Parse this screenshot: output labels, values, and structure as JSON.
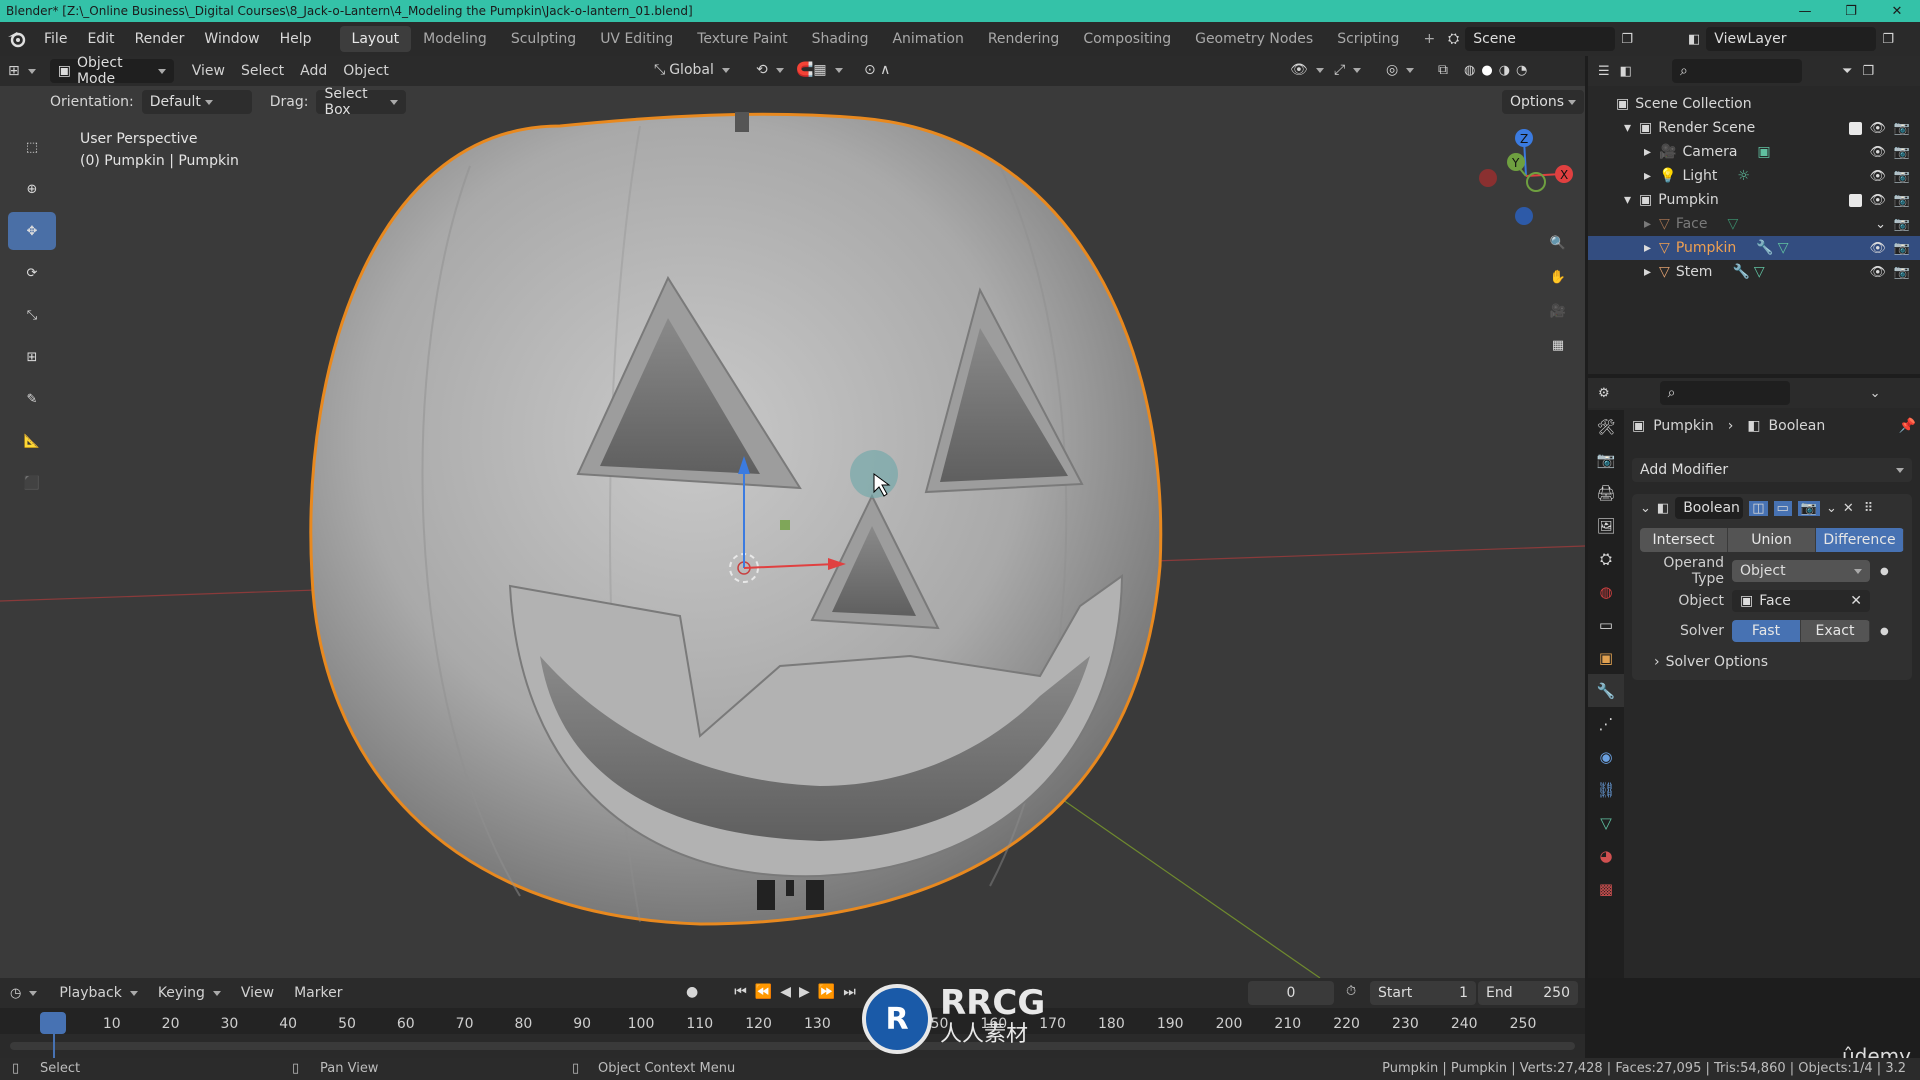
{
  "window": {
    "title": "Blender* [Z:\\_Online Business\\_Digital Courses\\8_Jack-o-Lantern\\4_Modeling the Pumpkin\\Jack-o-lantern_01.blend]",
    "controls": [
      "—",
      "❐",
      "✕"
    ]
  },
  "menu": [
    "File",
    "Edit",
    "Render",
    "Window",
    "Help"
  ],
  "workspaces": [
    "Layout",
    "Modeling",
    "Sculpting",
    "UV Editing",
    "Texture Paint",
    "Shading",
    "Animation",
    "Rendering",
    "Compositing",
    "Geometry Nodes",
    "Scripting"
  ],
  "active_workspace": "Layout",
  "scene_name": "Scene",
  "view_layer": "ViewLayer",
  "viewport_header": {
    "mode": "Object Mode",
    "menus": [
      "View",
      "Select",
      "Add",
      "Object"
    ],
    "transform_orientation": "Global",
    "orientation_label": "Orientation:",
    "orientation_value": "Default",
    "drag_label": "Drag:",
    "drag_value": "Select Box",
    "options": "Options"
  },
  "viewport": {
    "perspective": "User Perspective",
    "object_info": "(0) Pumpkin | Pumpkin"
  },
  "gizmo": {
    "z": "Z",
    "y": "Y",
    "x": "X"
  },
  "outliner": {
    "root": "Scene Collection",
    "rows": [
      {
        "label": "Render Scene",
        "indent": 1,
        "type": "collection"
      },
      {
        "label": "Camera",
        "indent": 2,
        "type": "camera"
      },
      {
        "label": "Light",
        "indent": 2,
        "type": "light"
      },
      {
        "label": "Pumpkin",
        "indent": 1,
        "type": "collection"
      },
      {
        "label": "Face",
        "indent": 2,
        "type": "mesh-hidden"
      },
      {
        "label": "Pumpkin",
        "indent": 2,
        "type": "mesh-selected"
      },
      {
        "label": "Stem",
        "indent": 2,
        "type": "mesh"
      }
    ]
  },
  "properties": {
    "breadcrumb_object": "Pumpkin",
    "breadcrumb_modifier": "Boolean",
    "add_modifier": "Add Modifier",
    "modifier_name": "Boolean",
    "operations": [
      "Intersect",
      "Union",
      "Difference"
    ],
    "active_operation": "Difference",
    "operand_type_label": "Operand Type",
    "operand_type_value": "Object",
    "object_label": "Object",
    "object_value": "Face",
    "solver_label": "Solver",
    "solvers": [
      "Fast",
      "Exact"
    ],
    "active_solver": "Fast",
    "solver_options": "Solver Options"
  },
  "timeline": {
    "menus": [
      "Playback",
      "Keying",
      "View",
      "Marker"
    ],
    "current_frame": "0",
    "start_label": "Start",
    "start_value": "1",
    "end_label": "End",
    "end_value": "250",
    "ticks": [
      "0",
      "10",
      "20",
      "30",
      "40",
      "50",
      "60",
      "70",
      "80",
      "90",
      "100",
      "110",
      "120",
      "130",
      "140",
      "150",
      "160",
      "170",
      "180",
      "190",
      "200",
      "210",
      "220",
      "230",
      "240",
      "250"
    ]
  },
  "watermark": {
    "brand": "RRCG",
    "sub": "人人素材",
    "udemy": "ûdemy"
  },
  "statusbar": {
    "left": "Select",
    "middle": "Pan View",
    "right": "Object Context Menu",
    "stats": "Pumpkin | Pumpkin | Verts:27,428 | Faces:27,095 | Tris:54,860 | Objects:1/4 | 3.2"
  },
  "colors": {
    "titlebar": "#34c2a8",
    "accent_blue": "#4772b3",
    "selection_outline": "#e8891f",
    "viewport_bg": "#3a3a3a"
  }
}
